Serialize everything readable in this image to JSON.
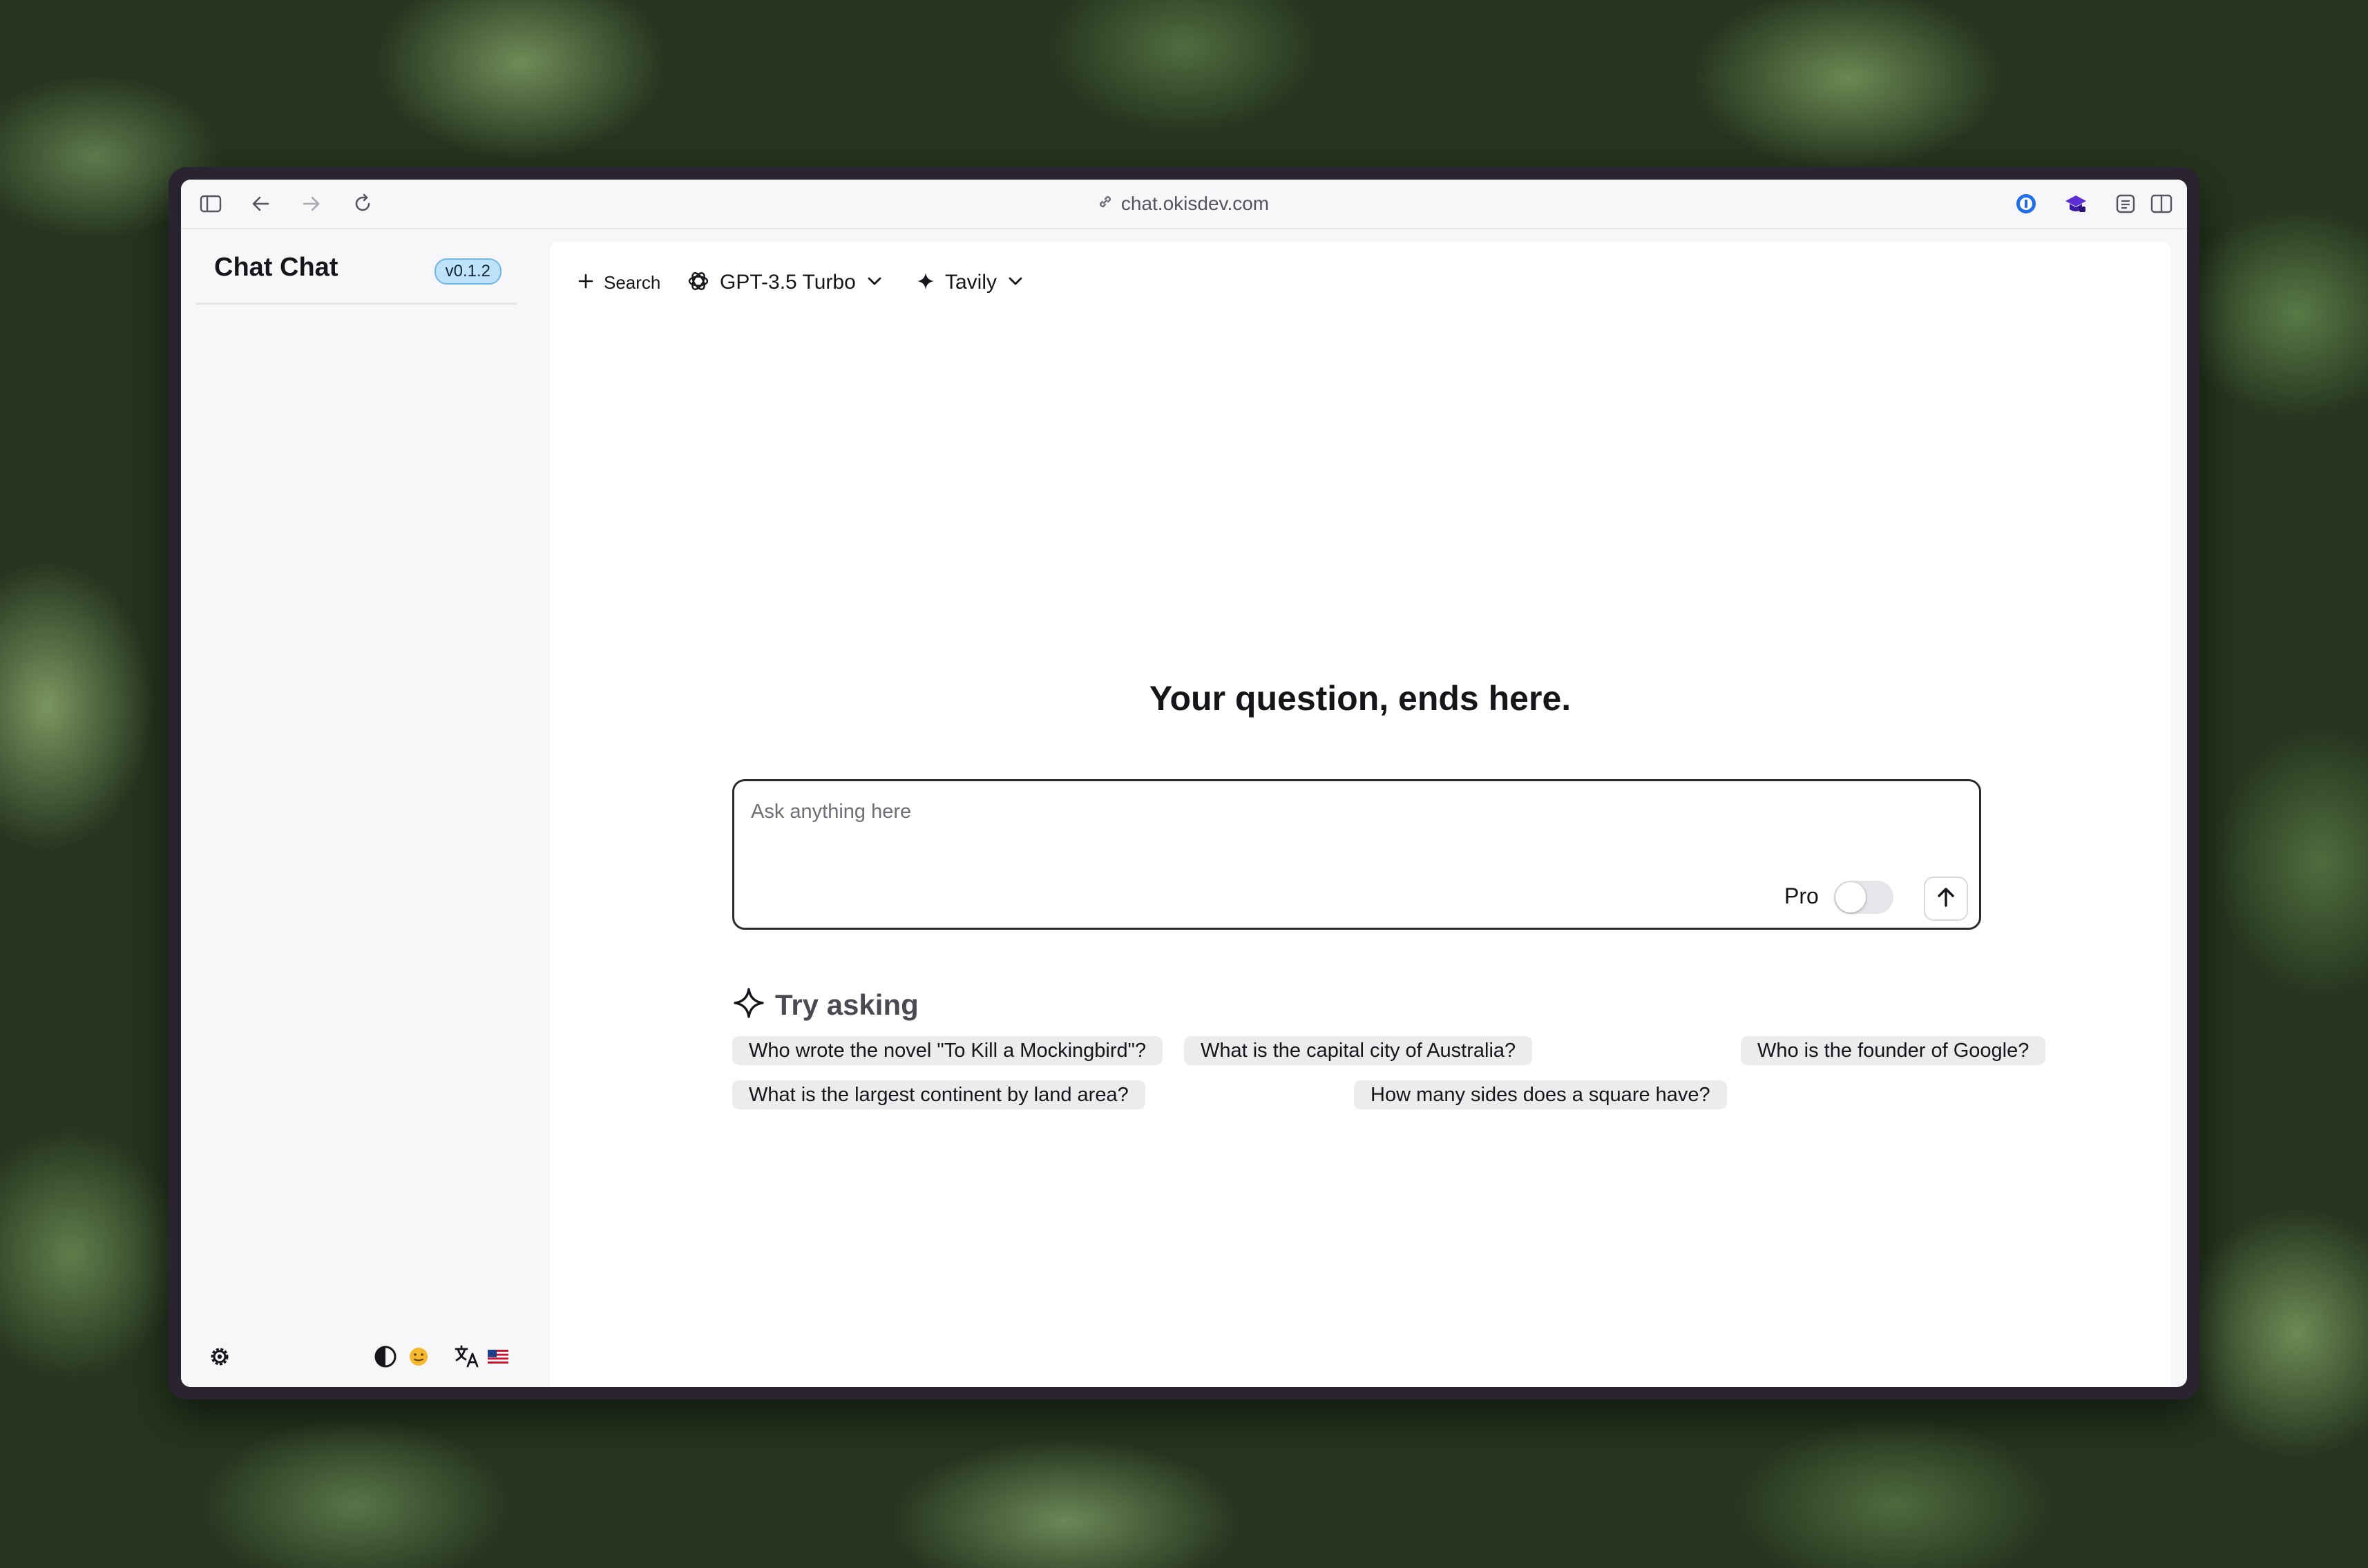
{
  "browser": {
    "url": "chat.okisdev.com",
    "icons": [
      "sidebar-toggle-icon",
      "back-arrow-icon",
      "forward-arrow-icon",
      "reload-icon",
      "link-icon",
      "password-manager-icon",
      "graduation-cap-icon",
      "reader-icon",
      "split-view-icon"
    ]
  },
  "sidebar": {
    "app_name": "Chat Chat",
    "version": "v0.1.2",
    "footer_icons": [
      "settings-gear-icon",
      "theme-contrast-icon",
      "emoji-icon",
      "translate-icon",
      "us-flag-icon"
    ]
  },
  "topbar": {
    "new_search_label": "Search",
    "model_label": "GPT-3.5 Turbo",
    "search_engine_label": "Tavily"
  },
  "hero": {
    "title": "Your question, ends here."
  },
  "ask": {
    "placeholder": "Ask anything here",
    "pro_label": "Pro",
    "pro_enabled": false
  },
  "suggestions": {
    "title": "Try asking",
    "items": [
      "Who wrote the novel \"To Kill a Mockingbird\"?",
      "What is the capital city of Australia?",
      "Who is the founder of Google?",
      "What is the largest continent by land area?",
      "How many sides does a square have?"
    ]
  },
  "colors": {
    "window_frame": "#2a2430",
    "version_badge_bg": "#bfe2fb",
    "version_badge_border": "#6fb7e8",
    "chip_bg": "#ececef",
    "password_manager": "#1f6feb",
    "graduation_cap": "#5b2ed6"
  }
}
